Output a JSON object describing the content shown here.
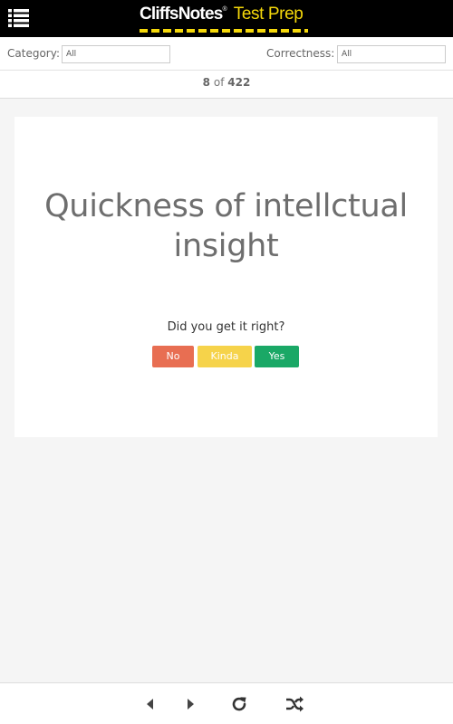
{
  "header": {
    "brand_main": "CliffsNotes",
    "brand_reg": "®",
    "brand_sub": "Test Prep",
    "menu_icon": "list-menu-icon"
  },
  "filters": {
    "category_label": "Category:",
    "category_value": "All",
    "correctness_label": "Correctness:",
    "correctness_value": "All"
  },
  "counter": {
    "current": "8",
    "separator": "of",
    "total": "422"
  },
  "card": {
    "term": "Quickness of intellctual insight",
    "prompt": "Did you get it right?",
    "buttons": {
      "no": "No",
      "kinda": "Kinda",
      "yes": "Yes"
    }
  },
  "footer": {
    "icons": [
      "caret-left-icon",
      "caret-right-icon",
      "refresh-icon",
      "shuffle-icon"
    ]
  },
  "colors": {
    "header_bg": "#000000",
    "brand_accent": "#f5d80a",
    "no": "#e86e52",
    "kinda": "#f6d34a",
    "yes": "#1aa866"
  }
}
